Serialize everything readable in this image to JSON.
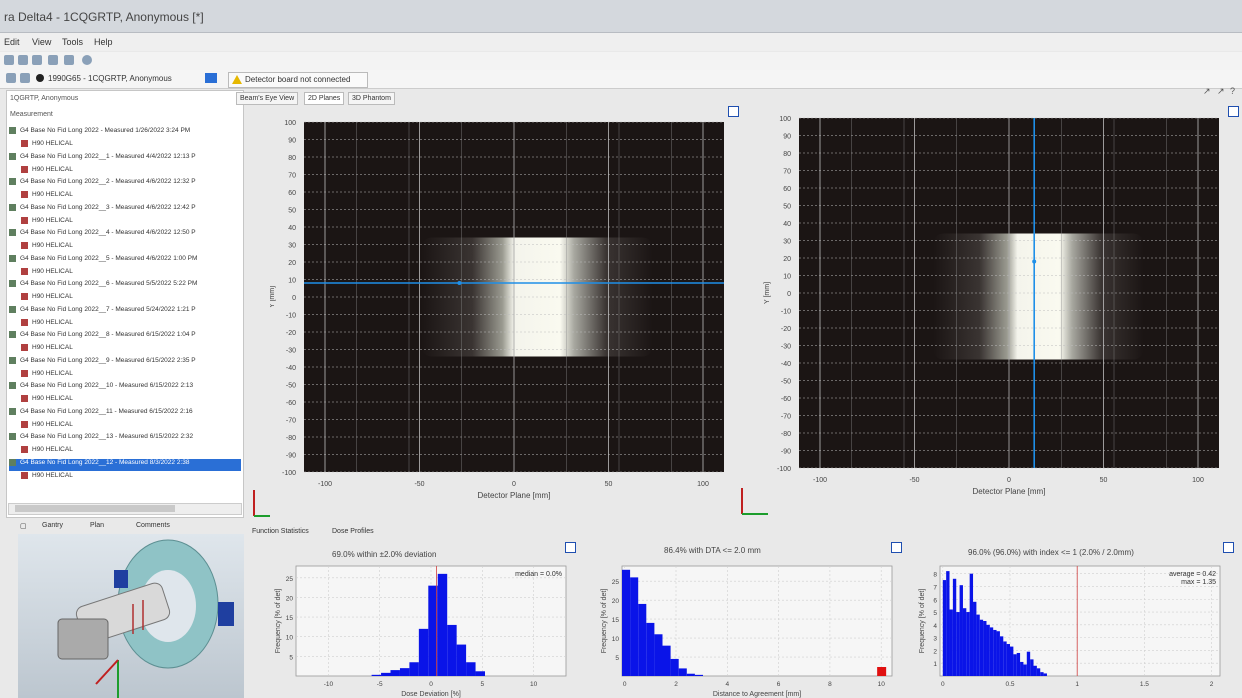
{
  "window": {
    "title": "ra Delta4 - 1CQGRTP, Anonymous [*]"
  },
  "menu": {
    "items": [
      "Edit",
      "View",
      "Tools",
      "Help"
    ]
  },
  "status": {
    "patient": "1990G65 - 1CQGRTP, Anonymous",
    "warning": "Detector board not connected"
  },
  "tree": {
    "header": "1QGRTP, Anonymous",
    "section": "Measurement",
    "rows": [
      {
        "label": "G4 Base No Fid Long 2022 - Measured   1/26/2022 3:24 PM",
        "child": "H90 HELICAL"
      },
      {
        "label": "G4 Base No Fid Long 2022__1 - Measured   4/4/2022 12:13 P",
        "child": "H90 HELICAL"
      },
      {
        "label": "G4 Base No Fid Long 2022__2 - Measured   4/6/2022 12:32 P",
        "child": "H90 HELICAL"
      },
      {
        "label": "G4 Base No Fid Long 2022__3 - Measured   4/6/2022 12:42 P",
        "child": "H90 HELICAL"
      },
      {
        "label": "G4 Base No Fid Long 2022__4 - Measured   4/6/2022 12:50 P",
        "child": "H90 HELICAL"
      },
      {
        "label": "G4 Base No Fid Long 2022__5 - Measured   4/6/2022 1:00 PM",
        "child": "H90 HELICAL"
      },
      {
        "label": "G4 Base No Fid Long 2022__6 - Measured   5/5/2022 5:22 PM",
        "child": "H90 HELICAL"
      },
      {
        "label": "G4 Base No Fid Long 2022__7 - Measured   5/24/2022 1:21 P",
        "child": "H90 HELICAL"
      },
      {
        "label": "G4 Base No Fid Long 2022__8 - Measured   6/15/2022 1:04 P",
        "child": "H90 HELICAL"
      },
      {
        "label": "G4 Base No Fid Long 2022__9 - Measured   6/15/2022 2:35 P",
        "child": "H90 HELICAL"
      },
      {
        "label": "G4 Base No Fid Long 2022__10 - Measured   6/15/2022 2:13",
        "child": "H90 HELICAL"
      },
      {
        "label": "G4 Base No Fid Long 2022__11 - Measured   6/15/2022 2:16",
        "child": "H90 HELICAL"
      },
      {
        "label": "G4 Base No Fid Long 2022__13 - Measured   6/15/2022 2:32",
        "child": "H90 HELICAL"
      },
      {
        "label": "G4 Base No Fid Long 2022__12 - Measured   8/3/2022 2:38",
        "child": "H90 HELICAL",
        "selected": true
      }
    ]
  },
  "view3d_tabs": [
    "Gantry",
    "Plan",
    "Comments"
  ],
  "main_tabs": [
    "Beam's Eye View",
    "2D Planes",
    "3D Phantom"
  ],
  "bottom_tabs": [
    "Function Statistics",
    "Dose Profiles"
  ],
  "plane_left": {
    "yaxis_label": "Y [mm]",
    "xaxis_label": "Detector Plane [mm]",
    "yticks": [
      "100",
      "90",
      "80",
      "70",
      "60",
      "50",
      "40",
      "30",
      "20",
      "10",
      "0",
      "-10",
      "-20",
      "-30",
      "-40",
      "-50",
      "-60",
      "-70",
      "-80",
      "-90",
      "-100"
    ],
    "xticks": [
      "-100",
      "-50",
      "0",
      "50",
      "100"
    ]
  },
  "plane_right": {
    "yaxis_label": "Y [mm]",
    "xaxis_label": "Detector Plane [mm]",
    "yticks": [
      "100",
      "90",
      "80",
      "70",
      "60",
      "50",
      "40",
      "30",
      "20",
      "10",
      "0",
      "-10",
      "-20",
      "-30",
      "-40",
      "-50",
      "-60",
      "-70",
      "-80",
      "-90",
      "-100"
    ],
    "xticks": [
      "-100",
      "-50",
      "0",
      "50",
      "100"
    ]
  },
  "histo1": {
    "title": "69.0% within ±2.0% deviation",
    "note": "median = 0.0%",
    "ylabel": "Frequency [% of det]",
    "xlabel": "Dose Deviation [%]",
    "yticks": [
      "25",
      "20",
      "15",
      "10",
      "5"
    ],
    "xticks": [
      "-10",
      "-5",
      "0",
      "5",
      "10"
    ],
    "bars": [
      0.3,
      0.8,
      1.5,
      2.0,
      3.5,
      12,
      23,
      26,
      13,
      8,
      3.5,
      1.2
    ]
  },
  "histo2": {
    "title": "86.4% with DTA <= 2.0 mm",
    "ylabel": "Frequency [% of det]",
    "xlabel": "Distance to Agreement [mm]",
    "yticks": [
      "25",
      "20",
      "15",
      "10",
      "5"
    ],
    "xticks": [
      "0",
      "2",
      "4",
      "6",
      "8",
      "10"
    ],
    "bars": [
      28,
      26,
      19,
      14,
      11,
      8,
      4.5,
      2,
      0.6,
      0.3
    ]
  },
  "histo3": {
    "title": "96.0% (96.0%) with index <= 1 (2.0% / 2.0mm)",
    "note": "average = 0.42\nmax = 1.35",
    "ylabel": "Frequency [% of det]",
    "yticks": [
      "8",
      "7",
      "6",
      "5",
      "4",
      "3",
      "2",
      "1"
    ],
    "xticks": [
      "0",
      "0.5",
      "1",
      "1.5",
      "2"
    ],
    "bars": [
      7.5,
      8.2,
      5.2,
      7.6,
      5.0,
      7.1,
      5.3,
      5.0,
      8.0,
      5.8,
      4.8,
      4.4,
      4.3,
      4.0,
      3.8,
      3.6,
      3.5,
      3.1,
      2.7,
      2.5,
      2.3,
      1.7,
      1.8,
      1.1,
      0.9,
      1.9,
      1.3,
      0.8,
      0.6,
      0.3,
      0.2
    ]
  },
  "colors": {
    "beam_line": "#1e8fe8",
    "bars": "#0a14e8",
    "outlier": "#e01010"
  }
}
